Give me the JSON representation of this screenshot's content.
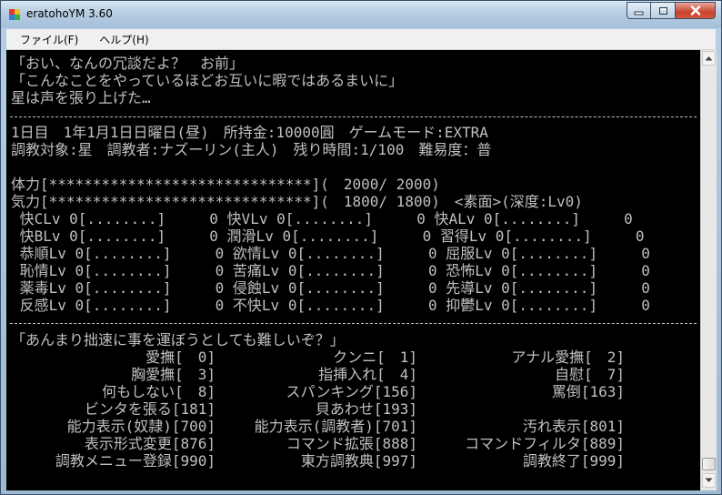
{
  "window": {
    "title": "eratohoYM 3.60",
    "icons": {
      "app": "era-app-icon",
      "minimize": "minimize-icon",
      "maximize": "maximize-icon",
      "close": "close-icon"
    }
  },
  "menu": {
    "file": "ファイル(F)",
    "help": "ヘルプ(H)"
  },
  "console": {
    "dialogue": [
      "「おい、なんの冗談だよ？　お前」",
      "「こんなことをやっているほどお互いに暇ではあるまいに」",
      "星は声を張り上げた…"
    ],
    "status_line1": "1日目　1年1月1日日曜日(昼)　所持金:10000圓　ゲームモード:EXTRA",
    "status_line2": "調教対象:星　調教者:ナズーリン(主人)　残り時間:1/100　難易度：普",
    "hp_line": "体力[******************************](　2000/ 2000)",
    "mp_line": "気力[******************************](　1800/ 1800)　<素面>(深度:Lv0)",
    "abilities": [
      " 快CLv 0[........]     0 快VLv 0[........]     0 快ALv 0[........]     0",
      " 快BLv 0[........]     0 潤滑Lv 0[........]     0 習得Lv 0[........]     0",
      " 恭順Lv 0[........]     0 欲情Lv 0[........]     0 屈服Lv 0[........]     0",
      " 恥情Lv 0[........]     0 苦痛Lv 0[........]     0 恐怖Lv 0[........]     0",
      " 薬毒Lv 0[........]     0 侵蝕Lv 0[........]     0 先導Lv 0[........]     0",
      " 反感Lv 0[........]     0 不快Lv 0[........]     0 抑鬱Lv 0[........]     0"
    ],
    "prompt": "「あんまり拙速に事を運ぼうとしても難しいぞ？」",
    "commands": [
      [
        "愛撫[　0]",
        "クンニ[　1]",
        "アナル愛撫[　2]"
      ],
      [
        "胸愛撫[　3]",
        "指挿入れ[　4]",
        "自慰[　7]"
      ],
      [
        "何もしない[　8]",
        "スパンキング[156]",
        "罵倒[163]"
      ],
      [
        "ビンタを張る[181]",
        "貝あわせ[193]",
        ""
      ],
      [
        "能力表示(奴隷)[700]",
        "能力表示(調教者)[701]",
        "汚れ表示[801]"
      ],
      [
        "表示形式変更[876]",
        "コマンド拡張[888]",
        "コマンドフィルタ[889]"
      ],
      [
        "調教メニュー登録[990]",
        "東方調教典[997]",
        "調教終了[999]"
      ]
    ]
  },
  "scrollbar": {
    "up_icon": "arrow-up-icon",
    "down_icon": "arrow-down-icon",
    "position": 0.97
  }
}
